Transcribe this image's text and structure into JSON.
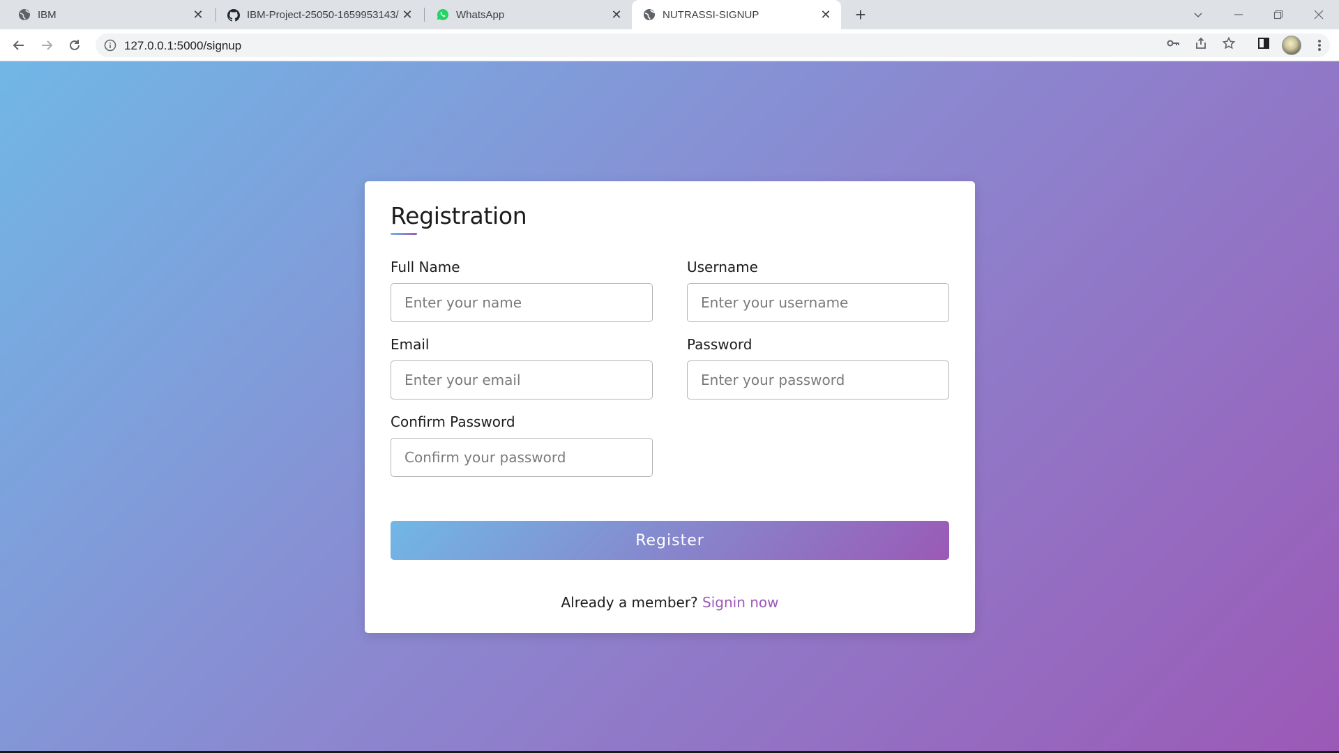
{
  "browser": {
    "tabs": [
      {
        "title": "IBM",
        "icon": "globe-icon",
        "active": false
      },
      {
        "title": "IBM-Project-25050-1659953143/",
        "icon": "github-icon",
        "active": false
      },
      {
        "title": "WhatsApp",
        "icon": "whatsapp-icon",
        "active": false
      },
      {
        "title": "NUTRASSI-SIGNUP",
        "icon": "globe-icon",
        "active": true
      }
    ],
    "url": "127.0.0.1:5000/signup"
  },
  "form": {
    "title": "Registration",
    "fields": {
      "full_name": {
        "label": "Full Name",
        "placeholder": "Enter your name"
      },
      "username": {
        "label": "Username",
        "placeholder": "Enter your username"
      },
      "email": {
        "label": "Email",
        "placeholder": "Enter your email"
      },
      "password": {
        "label": "Password",
        "placeholder": "Enter your password"
      },
      "confirm_password": {
        "label": "Confirm Password",
        "placeholder": "Confirm your password"
      }
    },
    "submit_label": "Register",
    "signin_prompt": "Already a member?",
    "signin_link": "Signin now"
  },
  "colors": {
    "gradient_start": "#71b7e6",
    "gradient_end": "#9b59b6",
    "link": "#9b59b6"
  }
}
